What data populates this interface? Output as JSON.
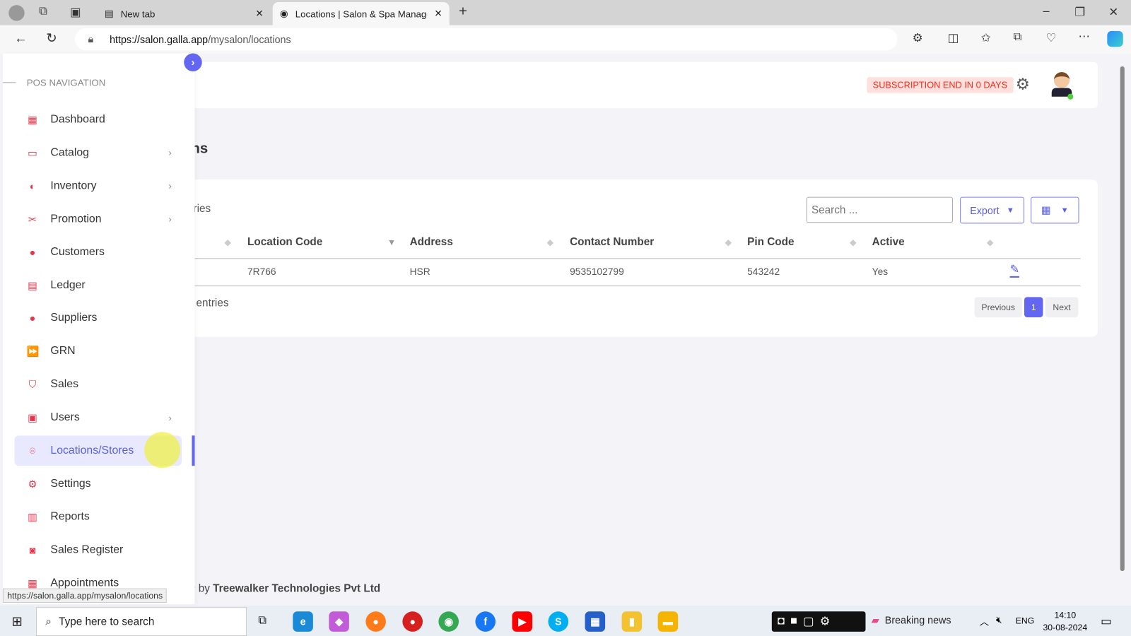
{
  "browser": {
    "tabs": [
      {
        "label": "New tab"
      },
      {
        "label": "Locations | Salon & Spa Managem"
      }
    ],
    "url_domain": "https://salon.galla.app",
    "url_path": "/mysalon/locations",
    "status_url": "https://salon.galla.app/mysalon/locations"
  },
  "header": {
    "subscription": "SUBSCRIPTION END IN 0 DAYS",
    "page_title_fragment": "ns"
  },
  "sidebar": {
    "heading": "POS NAVIGATION",
    "items": [
      {
        "label": "Dashboard",
        "icon": "dashboard-icon",
        "glyph": "▦"
      },
      {
        "label": "Catalog",
        "icon": "folder-icon",
        "glyph": "▭",
        "chevron": true
      },
      {
        "label": "Inventory",
        "icon": "half-circle-icon",
        "glyph": "◐",
        "chevron": true
      },
      {
        "label": "Promotion",
        "icon": "ticket-icon",
        "glyph": "✂",
        "chevron": true
      },
      {
        "label": "Customers",
        "icon": "user-circle-icon",
        "glyph": "●"
      },
      {
        "label": "Ledger",
        "icon": "document-icon",
        "glyph": "▤"
      },
      {
        "label": "Suppliers",
        "icon": "user-circle-icon",
        "glyph": "●"
      },
      {
        "label": "GRN",
        "icon": "forward-icon",
        "glyph": "⏩"
      },
      {
        "label": "Sales",
        "icon": "basket-icon",
        "glyph": "⛉"
      },
      {
        "label": "Users",
        "icon": "users-icon",
        "glyph": "▣",
        "chevron": true
      },
      {
        "label": "Locations/Stores",
        "icon": "location-pin-icon",
        "glyph": "⌾",
        "selected": true
      },
      {
        "label": "Settings",
        "icon": "gear-icon",
        "glyph": "⚙"
      },
      {
        "label": "Reports",
        "icon": "report-icon",
        "glyph": "▥"
      },
      {
        "label": "Sales Register",
        "icon": "register-icon",
        "glyph": "◙"
      },
      {
        "label": "Appointments",
        "icon": "calendar-icon",
        "glyph": "▦"
      }
    ]
  },
  "table": {
    "show_entries_fragment": "ries",
    "search_placeholder": "Search ...",
    "export_label": "Export",
    "columns": [
      "Location Code",
      "Address",
      "Contact Number",
      "Pin Code",
      "Active"
    ],
    "rows": [
      [
        "7R766",
        "HSR",
        "9535102799",
        "543242",
        "Yes"
      ]
    ],
    "info_fragment": "entries",
    "pagination": {
      "previous": "Previous",
      "current": "1",
      "next": "Next"
    }
  },
  "footer": {
    "prefix": "by",
    "company": "Treewalker Technologies Pvt Ltd"
  },
  "taskbar": {
    "search_placeholder": "Type here to search",
    "news": "Breaking news",
    "lang": "ENG",
    "time": "14:10",
    "date": "30-08-2024"
  },
  "colors": {
    "accent": "#6366f1",
    "danger": "#ff2a1a",
    "sidebar_icon": "#e8344a"
  }
}
